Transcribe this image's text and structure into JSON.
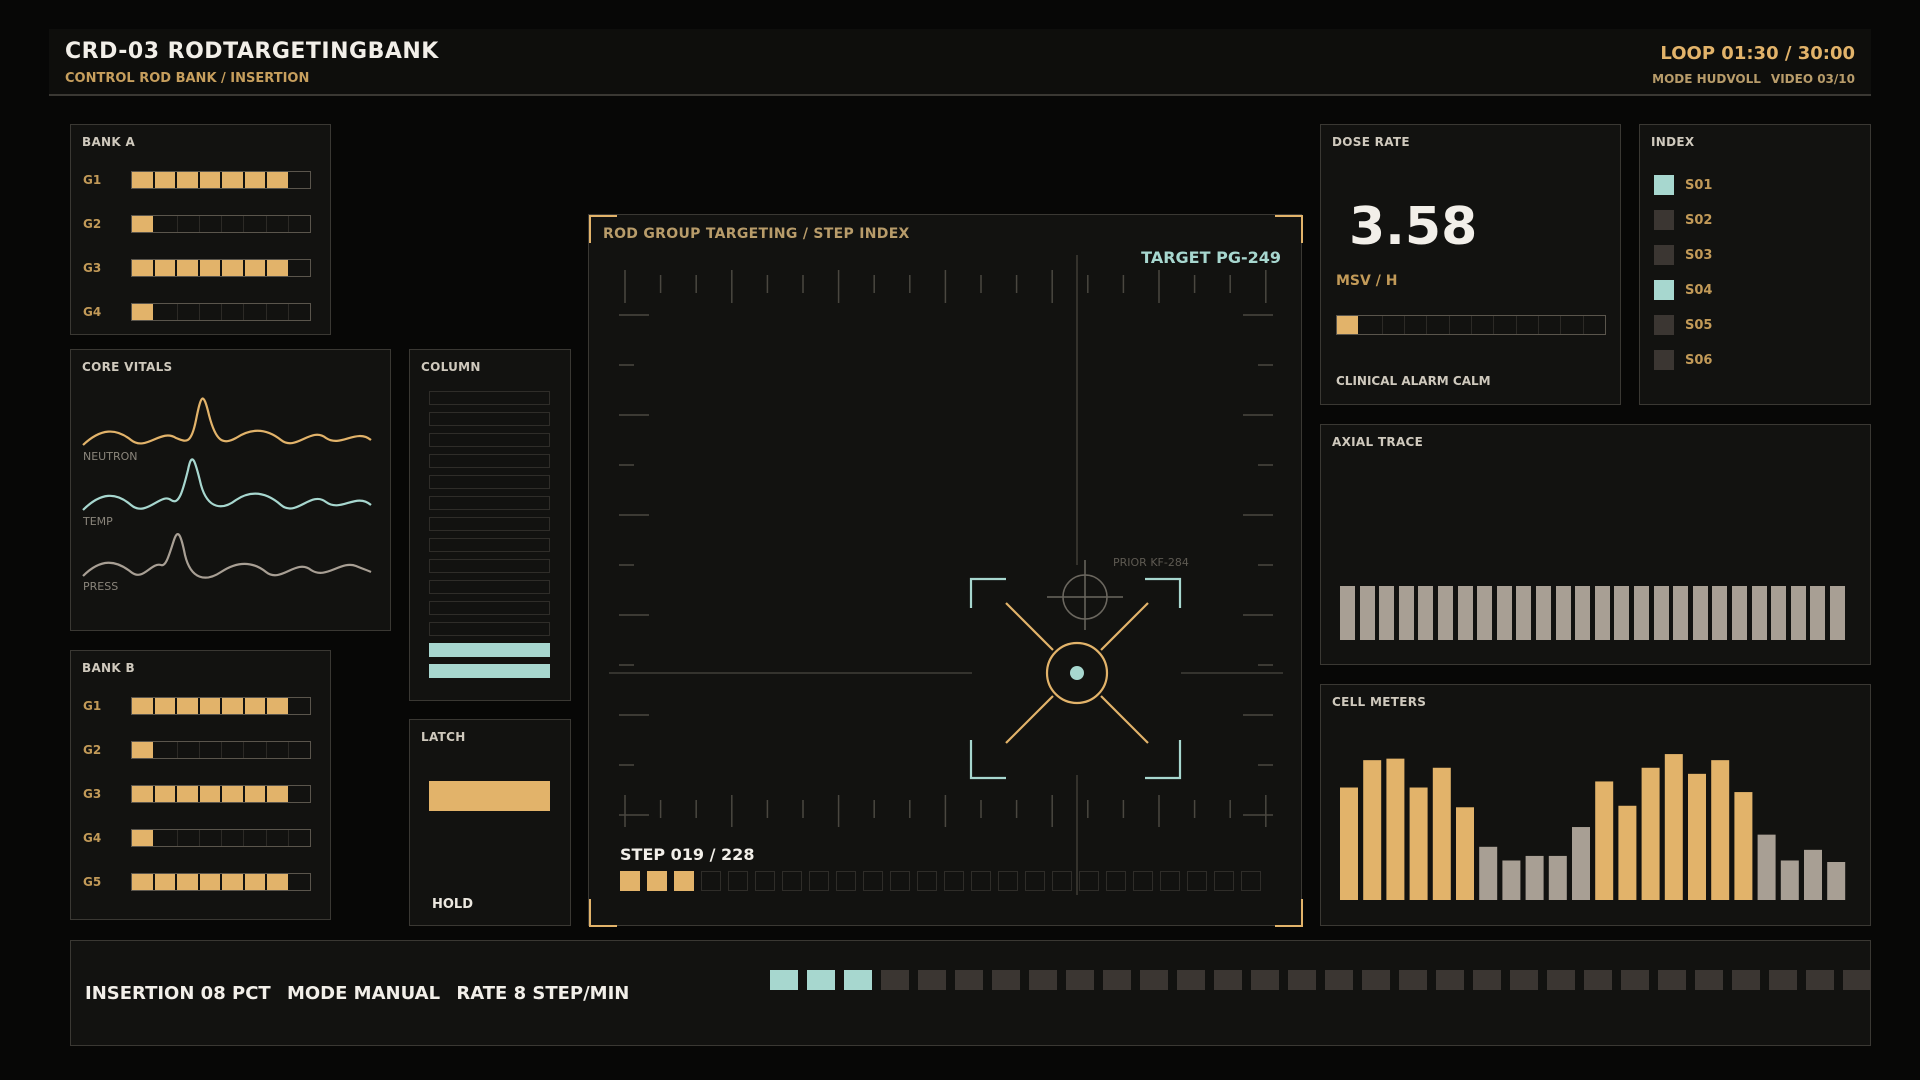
{
  "header": {
    "title": "CRD-03  RODTARGETINGBANK",
    "subtitle": "CONTROL ROD BANK / INSERTION",
    "loop": "LOOP 01:30 / 30:00",
    "mode": "MODE HUDVOLL",
    "video": "VIDEO 03/10"
  },
  "bank_a": {
    "label": "BANK A",
    "rows": [
      {
        "name": "G1",
        "fill": 7,
        "total": 8
      },
      {
        "name": "G2",
        "fill": 1,
        "total": 8
      },
      {
        "name": "G3",
        "fill": 7,
        "total": 8
      },
      {
        "name": "G4",
        "fill": 1,
        "total": 8
      }
    ]
  },
  "bank_b": {
    "label": "BANK B",
    "rows": [
      {
        "name": "G1",
        "fill": 7,
        "total": 8
      },
      {
        "name": "G2",
        "fill": 1,
        "total": 8
      },
      {
        "name": "G3",
        "fill": 7,
        "total": 8
      },
      {
        "name": "G4",
        "fill": 1,
        "total": 8
      },
      {
        "name": "G5",
        "fill": 7,
        "total": 8
      }
    ]
  },
  "core_vitals": {
    "label": "CORE VITALS",
    "traces": [
      {
        "name": "NEUTRON",
        "color": "#e2b36a"
      },
      {
        "name": "TEMP",
        "color": "#a7d7cf"
      },
      {
        "name": "PRESS",
        "color": "#a89f94"
      }
    ]
  },
  "column": {
    "label": "COLUMN",
    "cells": 14,
    "filled": 2
  },
  "latch": {
    "label": "LATCH",
    "state": "HOLD"
  },
  "targeting": {
    "label": "ROD GROUP TARGETING / STEP INDEX",
    "target": "TARGET PG-249",
    "prior": "PRIOR KF-284",
    "step": "STEP 019 / 228",
    "step_filled": 3,
    "step_total": 24
  },
  "dose_rate": {
    "label": "DOSE RATE",
    "value": "3.58",
    "unit": "MSV / H",
    "level": 1,
    "level_total": 12,
    "status": "CLINICAL ALARM CALM"
  },
  "index": {
    "label": "INDEX",
    "items": [
      {
        "name": "S01",
        "active": true
      },
      {
        "name": "S02",
        "active": false
      },
      {
        "name": "S03",
        "active": false
      },
      {
        "name": "S04",
        "active": true
      },
      {
        "name": "S05",
        "active": false
      },
      {
        "name": "S06",
        "active": false
      }
    ]
  },
  "axial_trace": {
    "label": "AXIAL TRACE",
    "bars": 26
  },
  "cell_meters": {
    "label": "CELL METERS"
  },
  "footer": {
    "insertion": "INSERTION 08 PCT",
    "mode": "MODE MANUAL",
    "rate": "RATE 8 STEP/MIN",
    "seg_filled": 3,
    "seg_total": 30
  },
  "colors": {
    "amber": "#e2b36a",
    "teal": "#a7d7cf",
    "gray": "#a89f94",
    "off": "#3b3632"
  },
  "chart_data": {
    "type": "bar",
    "values": [
      0.74,
      0.92,
      0.93,
      0.74,
      0.87,
      0.61,
      0.35,
      0.26,
      0.29,
      0.29,
      0.48,
      0.78,
      0.62,
      0.87,
      0.96,
      0.83,
      0.92,
      0.71,
      0.43,
      0.26,
      0.33,
      0.25
    ],
    "colors": [
      "amber",
      "amber",
      "amber",
      "amber",
      "amber",
      "amber",
      "gray",
      "gray",
      "gray",
      "gray",
      "gray",
      "amber",
      "amber",
      "amber",
      "amber",
      "amber",
      "amber",
      "amber",
      "gray",
      "gray",
      "gray",
      "gray"
    ]
  }
}
